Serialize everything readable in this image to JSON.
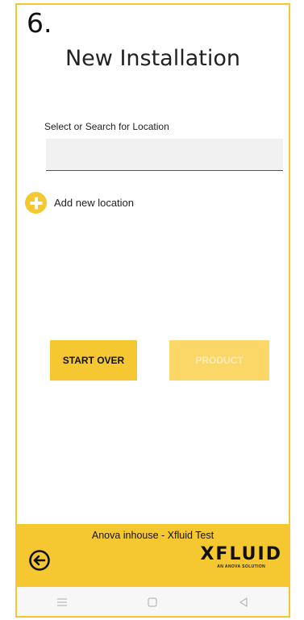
{
  "header": {
    "step_number": "6.",
    "title": "New Installation"
  },
  "location": {
    "label": "Select or Search for Location",
    "value": "",
    "placeholder": ""
  },
  "add_location": {
    "label": "Add new location",
    "icon": "plus-circle-icon"
  },
  "actions": {
    "start_over_label": "START OVER",
    "product_label": "PRODUCT",
    "product_enabled": false
  },
  "footer": {
    "org_name": "Anova inhouse - Xfluid Test",
    "back_icon": "arrow-left-circle-icon",
    "brand_name": "XFLUID",
    "brand_tagline": "AN ANOVA SOLUTION"
  },
  "navbar": {
    "icons": [
      "menu-icon",
      "home-square-icon",
      "back-triangle-icon"
    ]
  },
  "colors": {
    "accent": "#f5c831",
    "accent_disabled": "#fad767",
    "input_bg": "#f1f1f1",
    "navbar_bg": "#f7f7f7"
  }
}
